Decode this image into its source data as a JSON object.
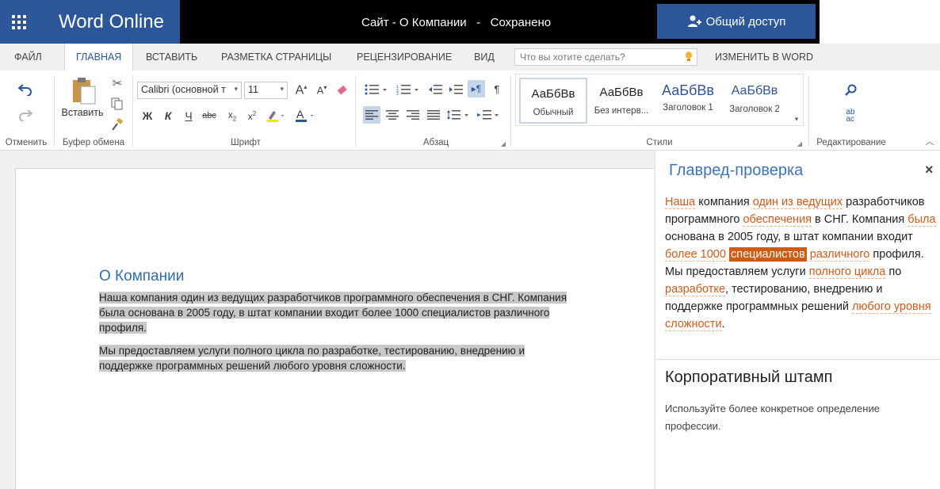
{
  "app": {
    "brand": "Word Online",
    "document_title": "Сайт - О Компании   -   Сохранено",
    "share_label": "Общий доступ"
  },
  "tabs": [
    {
      "label": "ФАЙЛ"
    },
    {
      "label": "ГЛАВНАЯ"
    },
    {
      "label": "ВСТАВИТЬ"
    },
    {
      "label": "РАЗМЕТКА СТРАНИЦЫ"
    },
    {
      "label": "РЕЦЕНЗИРОВАНИЕ"
    },
    {
      "label": "ВИД"
    }
  ],
  "tell_me_placeholder": "Что вы хотите сделать?",
  "edit_in_word": "ИЗМЕНИТЬ В WORD",
  "ribbon": {
    "groups": {
      "undo": "Отменить",
      "clipboard": "Буфер обмена",
      "font": "Шрифт",
      "paragraph": "Абзац",
      "styles": "Стили",
      "editing": "Редактирование"
    },
    "paste_label": "Вставить",
    "font_name": "Calibri (основной т",
    "font_size": "11",
    "styles": [
      {
        "preview": "АаБбВв",
        "name": "Обычный"
      },
      {
        "preview": "АаБбВв",
        "name": "Без интерв..."
      },
      {
        "preview": "АаБбВв",
        "name": "Заголовок 1"
      },
      {
        "preview": "АаБбВв",
        "name": "Заголовок 2"
      }
    ]
  },
  "document": {
    "heading": "О Компании",
    "p1_line1": "Наша компания один из ведущих разработчиков программного обеспечения в СНГ. Компания",
    "p1_line2": "была основана в 2005 году, в штат компании входит более 1000 специалистов различного",
    "p1_line3": "профиля. ",
    "p2_line1": "Мы предоставляем услуги полного цикла по разработке, тестированию, внедрению и",
    "p2_line2": "поддержке программных решений любого уровня сложности."
  },
  "pane": {
    "title": "Главред-проверка",
    "close": "×",
    "t": [
      "Наша",
      " компания ",
      "один из ведущих",
      " разработчиков программного ",
      "обеспечения",
      " в СНГ. Компания ",
      "была",
      " основана в 2005 году, в штат компании входит ",
      "более 1000",
      " ",
      "специалистов",
      " ",
      "различного",
      " профиля.",
      "Мы предоставляем услуги ",
      "полного цикла",
      " по ",
      "разработке",
      ", тестированию, внедрению и поддержке программных решений ",
      "любого уровня сложности",
      "."
    ],
    "stamp_title": "Корпоративный штамп",
    "stamp_text": "Используйте более конкретное определение профессии."
  },
  "colors": {
    "brand_blue": "#2b579a",
    "highlight_orange": "#cf5a13",
    "heading_blue": "#2f6db5"
  }
}
